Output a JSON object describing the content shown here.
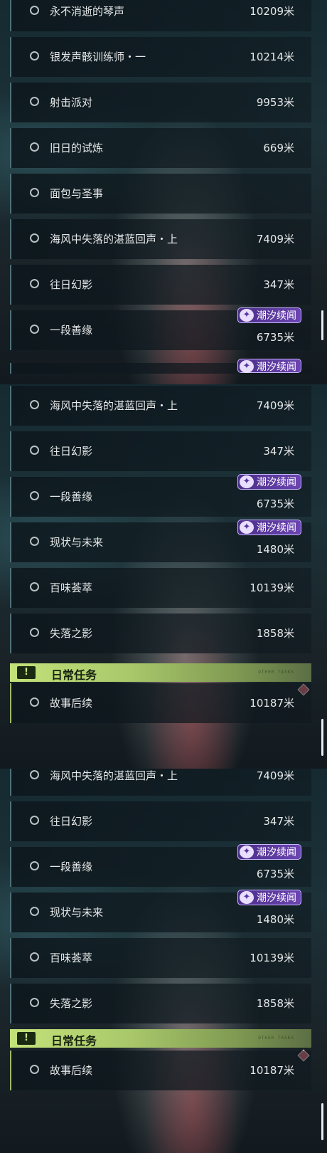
{
  "tag_label": "潮汐续闻",
  "tag_icon": "swirl-icon",
  "section_daily": {
    "badge": "!",
    "title": "日常任务",
    "decoration": "OTHER TASKS"
  },
  "panel1": {
    "rows": [
      {
        "name": "永不消逝的琴声",
        "distance": "10209米"
      },
      {
        "name": "银发声骸训练师・一",
        "distance": "10214米"
      },
      {
        "name": "射击派对",
        "distance": "9953米"
      },
      {
        "name": "旧日的试炼",
        "distance": "669米"
      },
      {
        "name": "面包与圣事",
        "distance": ""
      },
      {
        "name": "海风中失落的湛蓝回声・上",
        "distance": "7409米"
      },
      {
        "name": "往日幻影",
        "distance": "347米"
      },
      {
        "name": "一段善缘",
        "distance": "6735米"
      }
    ]
  },
  "panel2": {
    "rows": [
      {
        "name": "海风中失落的湛蓝回声・上",
        "distance": "7409米"
      },
      {
        "name": "往日幻影",
        "distance": "347米"
      },
      {
        "name": "一段善缘",
        "distance": "6735米"
      },
      {
        "name": "现状与未来",
        "distance": "1480米"
      },
      {
        "name": "百味荟萃",
        "distance": "10139米"
      },
      {
        "name": "失落之影",
        "distance": "1858米"
      }
    ],
    "daily": [
      {
        "name": "故事后续",
        "distance": "10187米"
      }
    ]
  },
  "panel3": {
    "rows": [
      {
        "name": "海风中失落的湛蓝回声・上",
        "distance": "7409米"
      },
      {
        "name": "往日幻影",
        "distance": "347米"
      },
      {
        "name": "一段善缘",
        "distance": "6735米"
      },
      {
        "name": "现状与未来",
        "distance": "1480米"
      },
      {
        "name": "百味荟萃",
        "distance": "10139米"
      },
      {
        "name": "失落之影",
        "distance": "1858米"
      }
    ],
    "daily": [
      {
        "name": "故事后续",
        "distance": "10187米"
      }
    ]
  }
}
